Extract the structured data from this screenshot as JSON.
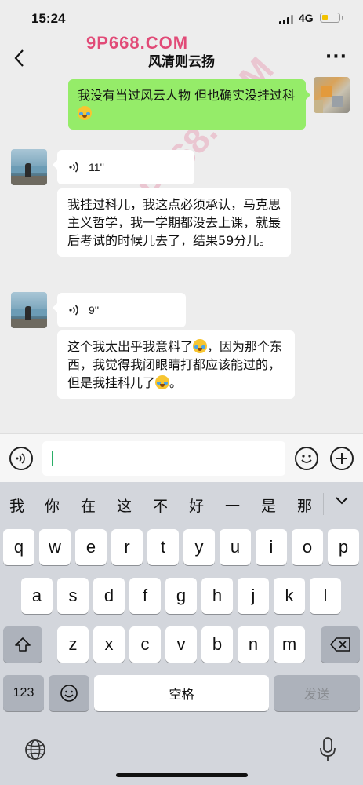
{
  "status_bar": {
    "time": "15:24",
    "network": "4G"
  },
  "header": {
    "title": "风清则云扬",
    "back_icon": "chevron-left-icon",
    "more_icon": "more-dots-icon"
  },
  "watermark": {
    "top": "9P668.COM",
    "diagonal": "9P668.COM"
  },
  "messages": [
    {
      "from": "self",
      "type": "text",
      "text": "我没有当过风云人物 但也确实没挂过科",
      "emoji": "laughing-crying-emoji"
    },
    {
      "from": "friend",
      "type": "voice",
      "duration": "11''"
    },
    {
      "from": "friend",
      "type": "text",
      "text": "我挂过科儿，我这点必须承认，马克思主义哲学，我一学期都没去上课，就最后考试的时候儿去了，结果59分儿。"
    },
    {
      "from": "friend",
      "type": "voice",
      "duration": "9''"
    },
    {
      "from": "friend",
      "type": "text",
      "text_a": "这个我太出乎我意料了",
      "text_b": "，因为那个东西，我觉得我闭眼睛打都应该能过的，但是我挂科儿了",
      "text_c": "。",
      "emoji": "loudly-crying-emoji"
    }
  ],
  "input_bar": {
    "voice_icon": "voice-input-icon",
    "emoji_icon": "emoji-icon",
    "plus_icon": "plus-icon",
    "value": ""
  },
  "keyboard": {
    "candidates": [
      "我",
      "你",
      "在",
      "这",
      "不",
      "好",
      "一",
      "是",
      "那"
    ],
    "row1": [
      "q",
      "w",
      "e",
      "r",
      "t",
      "y",
      "u",
      "i",
      "o",
      "p"
    ],
    "row2": [
      "a",
      "s",
      "d",
      "f",
      "g",
      "h",
      "j",
      "k",
      "l"
    ],
    "row3": [
      "z",
      "x",
      "c",
      "v",
      "b",
      "n",
      "m"
    ],
    "numbers_label": "123",
    "space_label": "空格",
    "send_label": "发送"
  },
  "colors": {
    "self_bubble": "#95ec69",
    "background": "#ededed",
    "keyboard": "#d3d6dc"
  }
}
